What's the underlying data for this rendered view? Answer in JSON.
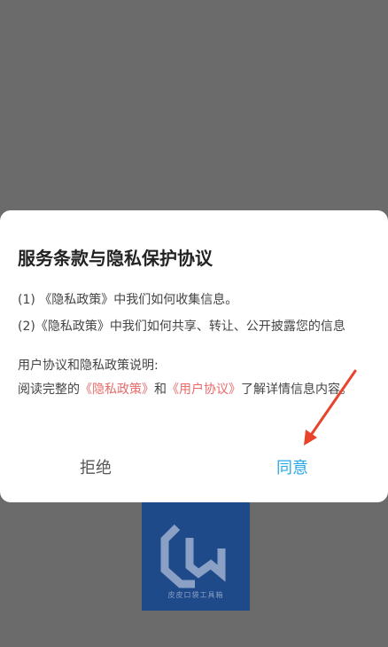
{
  "logo": {
    "caption": "皮皮口袋工具箱"
  },
  "dialog": {
    "title": "服务条款与隐私保护协议",
    "line1": "(1) 《隐私政策》中我们如何收集信息。",
    "line2": "(2)《隐私政策》中我们如何共享、转让、公开披露您的信息",
    "subhead": "用户协议和隐私政策说明:",
    "para_prefix": "阅读完整的",
    "privacy_link": "《隐私政策》",
    "para_and": "和",
    "user_link": "《用户协议》",
    "para_suffix": "了解详情信息内容。",
    "refuse_label": "拒绝",
    "agree_label": "同意"
  },
  "colors": {
    "overlay": "#6b6b6b",
    "link": "#e86a6a",
    "agree": "#27a8e8",
    "arrow": "#e8442c"
  }
}
